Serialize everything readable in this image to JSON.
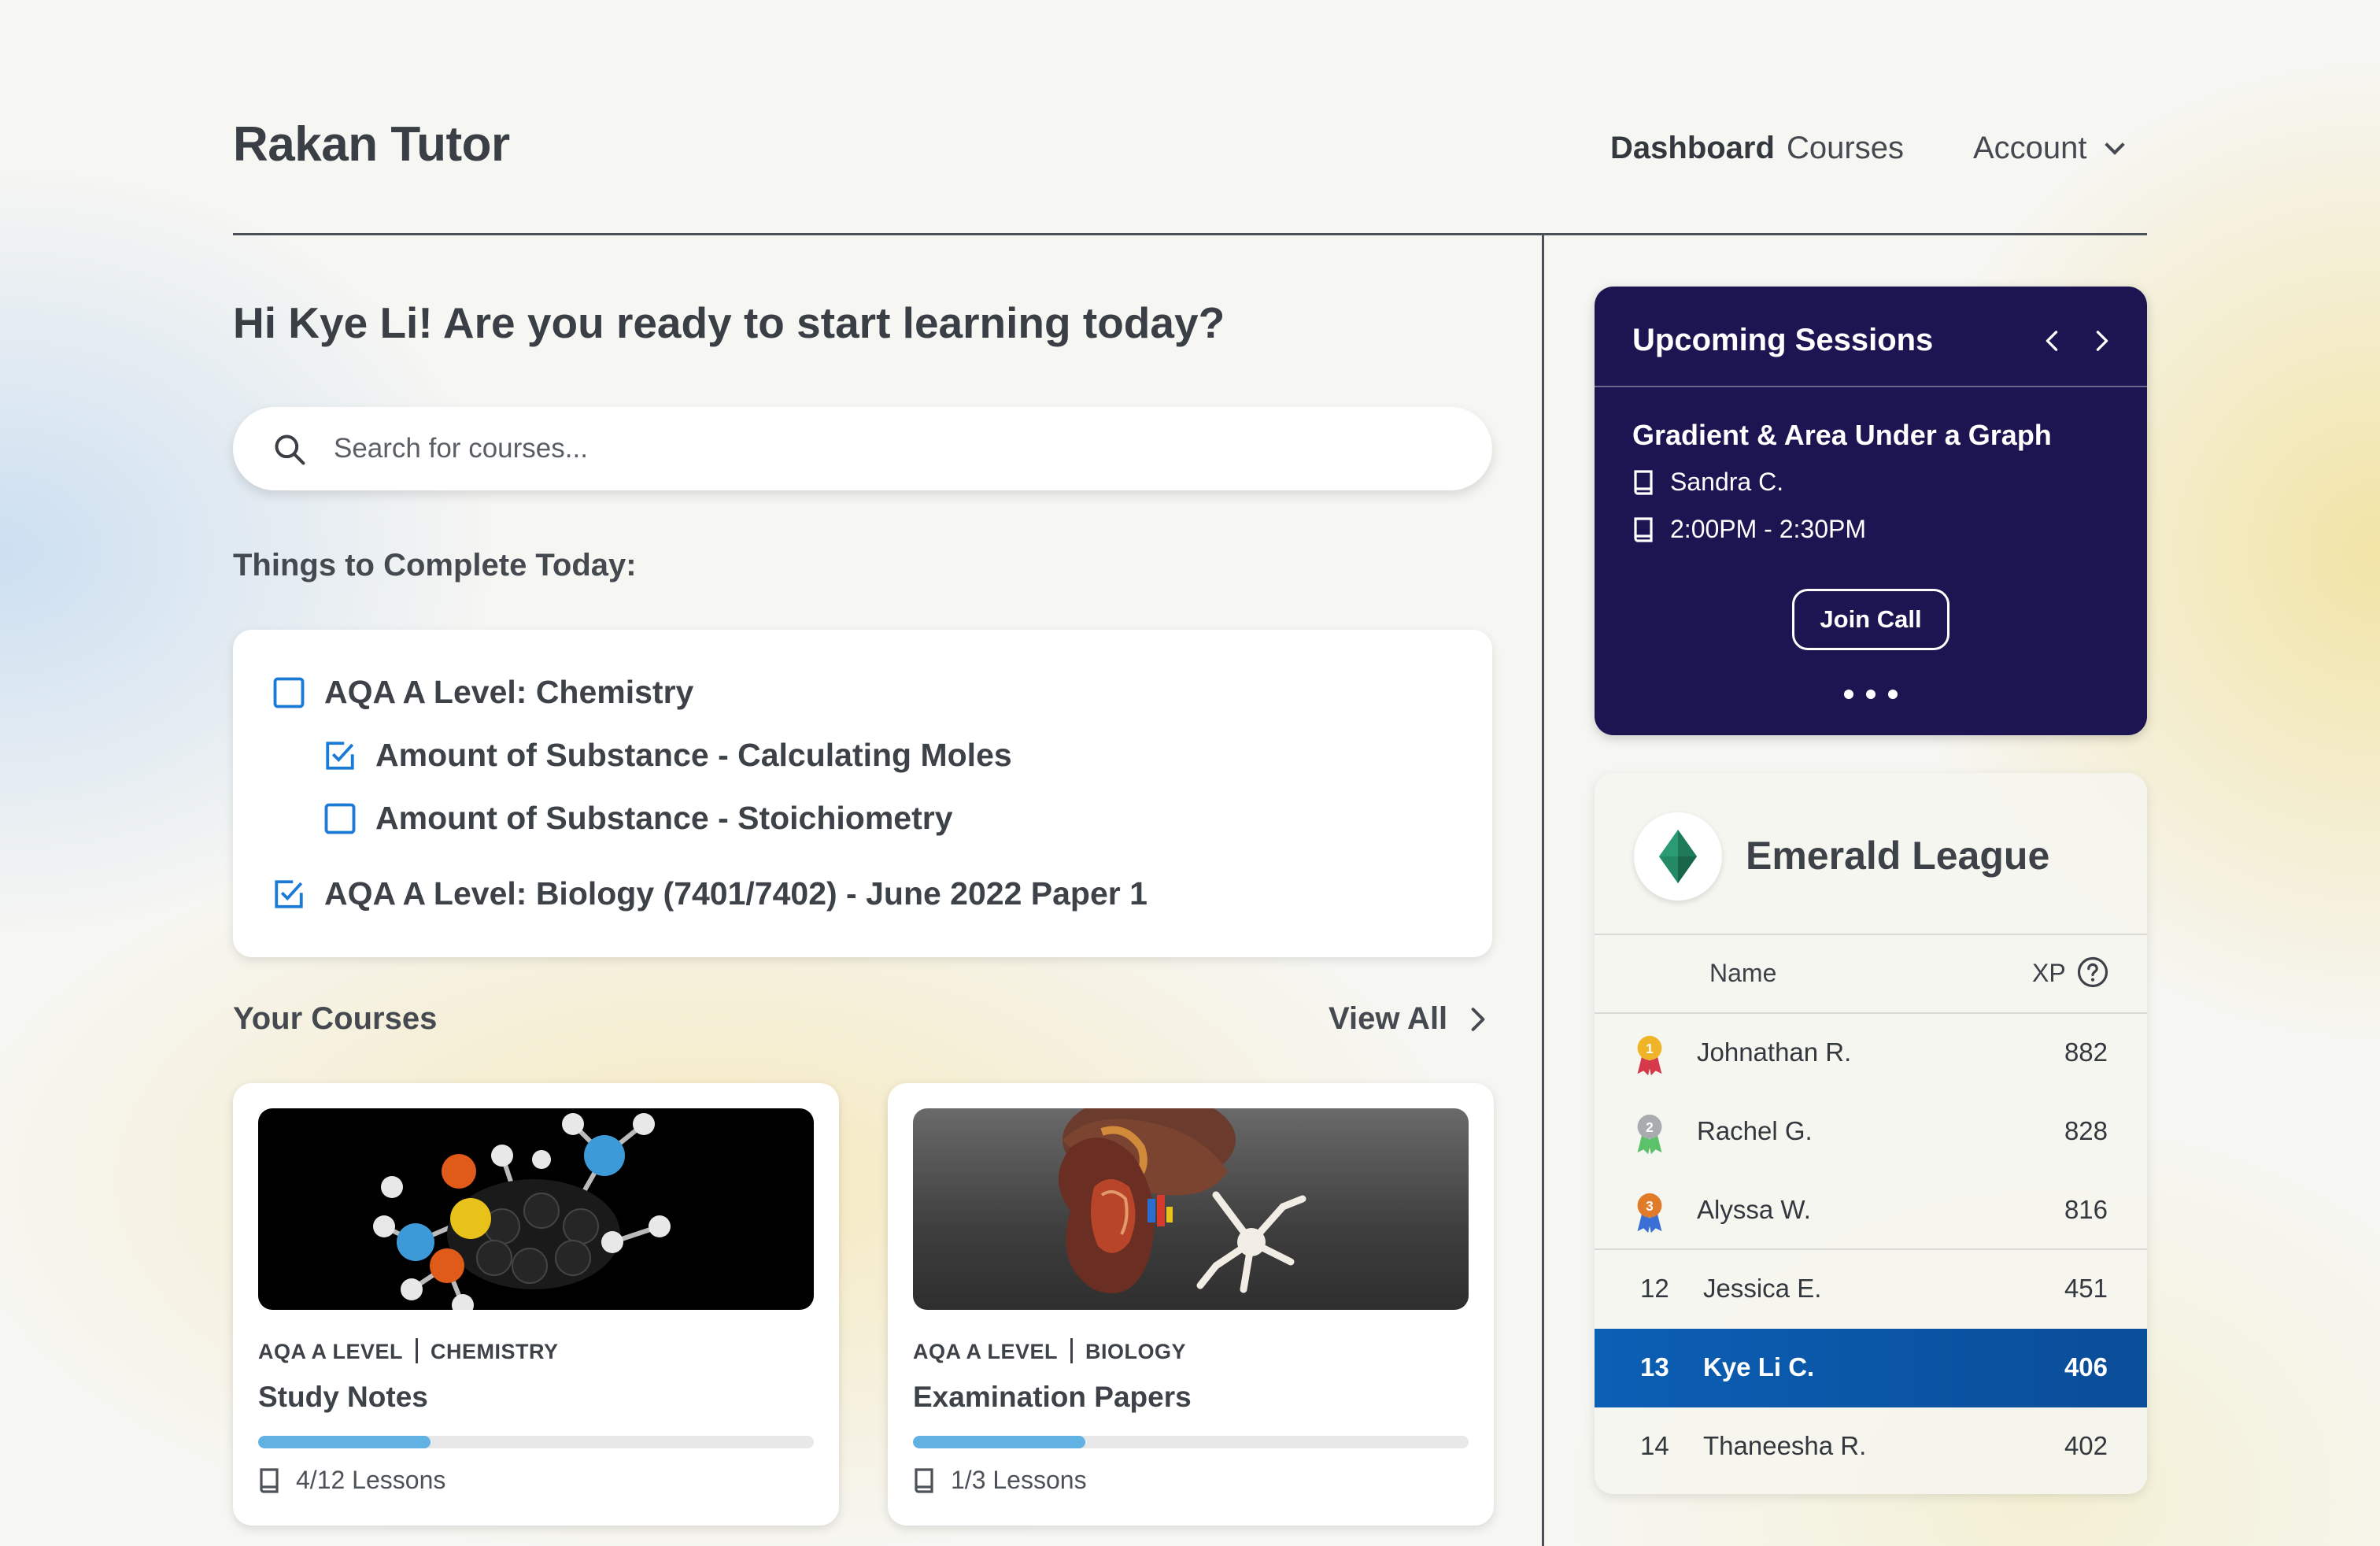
{
  "header": {
    "brand": "Rakan Tutor",
    "nav": [
      {
        "label": "Dashboard",
        "active": true
      },
      {
        "label": "Courses",
        "active": false
      },
      {
        "label": "Account",
        "active": false
      }
    ]
  },
  "greeting": "Hi Kye Li! Are you ready to start learning today?",
  "search": {
    "placeholder": "Search for courses..."
  },
  "todo": {
    "title": "Things to Complete Today:",
    "items": [
      {
        "label": "AQA A Level: Chemistry",
        "checked": false,
        "level": 0
      },
      {
        "label": "Amount of Substance - Calculating Moles",
        "checked": true,
        "level": 1
      },
      {
        "label": "Amount of Substance - Stoichiometry",
        "checked": false,
        "level": 1
      },
      {
        "label": "AQA A Level: Biology (7401/7402) - June 2022 Paper 1",
        "checked": true,
        "level": 0
      }
    ]
  },
  "courses": {
    "title": "Your Courses",
    "view_all": "View All",
    "items": [
      {
        "board": "AQA A LEVEL",
        "subject": "CHEMISTRY",
        "name": "Study Notes",
        "progress": 0.31,
        "lessons": "4/12 Lessons"
      },
      {
        "board": "AQA A LEVEL",
        "subject": "BIOLOGY",
        "name": "Examination Papers",
        "progress": 0.31,
        "lessons": "1/3 Lessons"
      }
    ]
  },
  "sessions": {
    "title": "Upcoming Sessions",
    "name": "Gradient & Area Under a Graph",
    "tutor": "Sandra C.",
    "time": "2:00PM - 2:30PM",
    "join_label": "Join Call"
  },
  "league": {
    "title": "Emerald League",
    "col_name": "Name",
    "col_xp": "XP",
    "top": [
      {
        "name": "Johnathan R.",
        "xp": "882",
        "medal": "1"
      },
      {
        "name": "Rachel G.",
        "xp": "828",
        "medal": "2"
      },
      {
        "name": "Alyssa W.",
        "xp": "816",
        "medal": "3"
      }
    ],
    "rest": [
      {
        "rank": "12",
        "name": "Jessica E.",
        "xp": "451"
      },
      {
        "rank": "13",
        "name": "Kye Li C.",
        "xp": "406"
      },
      {
        "rank": "14",
        "name": "Thaneesha R.",
        "xp": "402"
      }
    ]
  },
  "colors": {
    "sessions_bg": "#1c1551",
    "highlight": "#0b5fb5",
    "checkbox": "#1a7ad6",
    "progress": "#62b1e3",
    "emerald": "#2a9b72"
  }
}
